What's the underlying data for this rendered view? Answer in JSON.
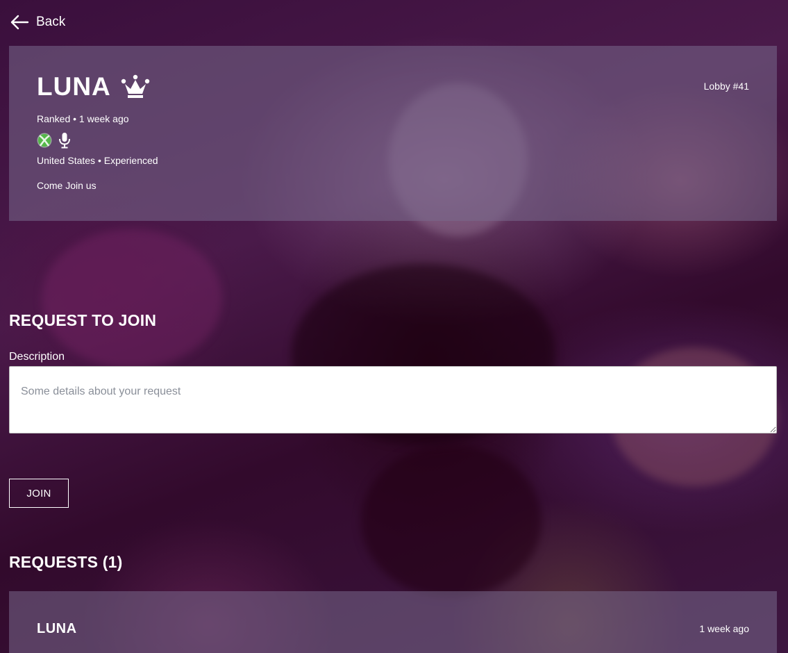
{
  "nav": {
    "back_label": "Back"
  },
  "lobby": {
    "host_name": "LUNA",
    "lobby_number": "Lobby #41",
    "mode_time": "Ranked • 1 week ago",
    "region_level": "United States • Experienced",
    "message": "Come Join us",
    "icons": [
      "crown-icon",
      "xbox-icon",
      "microphone-icon"
    ]
  },
  "join_form": {
    "title": "REQUEST TO JOIN",
    "description_label": "Description",
    "description_placeholder": "Some details about your request",
    "description_value": "",
    "join_label": "JOIN"
  },
  "requests": {
    "title": "REQUESTS (1)",
    "items": [
      {
        "name": "LUNA",
        "time": "1 week ago"
      }
    ]
  },
  "colors": {
    "card_bg": "#786c8c",
    "xbox_green": "#54b848",
    "text": "#ffffff"
  }
}
